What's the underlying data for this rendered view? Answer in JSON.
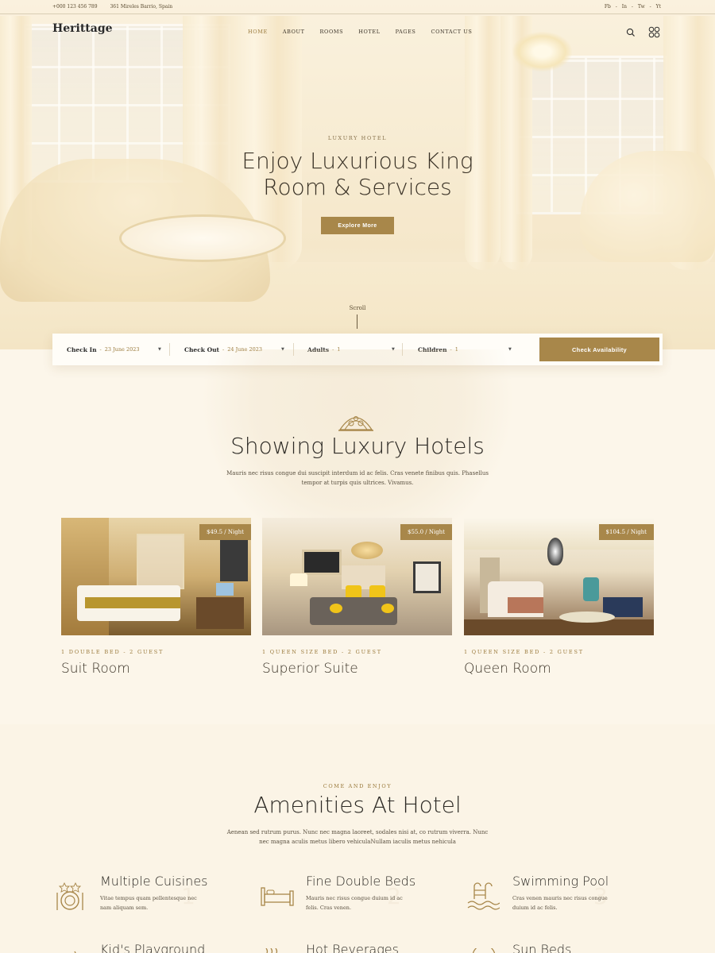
{
  "topbar": {
    "phone": "+000 123 456 789",
    "address": "361 Mireles Barrio, Spain",
    "social": [
      "Fb",
      "-",
      "In",
      "-",
      "Tw",
      "-",
      "Yt"
    ]
  },
  "brand": {
    "name": "Herittage",
    "tagline": ""
  },
  "nav": {
    "items": [
      "HOME",
      "ABOUT",
      "ROOMS",
      "HOTEL",
      "PAGES",
      "CONTACT US"
    ]
  },
  "hero": {
    "eyebrow": "LUXURY HOTEL",
    "title_line1": "Enjoy  Luxurious King",
    "title_line2": "Room & Services",
    "cta": "Explore More",
    "scroll": "Scroll"
  },
  "booking": {
    "checkin_label": "Check In",
    "checkin_value": "23 June 2023",
    "checkout_label": "Check Out",
    "checkout_value": "24 June 2023",
    "adults_label": "Adults",
    "adults_value": "1",
    "children_label": "Children",
    "children_value": "1",
    "button": "Check Availability"
  },
  "hotels": {
    "title": "Showing Luxury Hotels",
    "desc_line1": "Mauris nec risus congue dui suscipit interdum id ac felis. Cras venete finibus quis. Phasellus",
    "desc_line2": "tempor at turpis quis ultrices. Vivamus.",
    "rooms": [
      {
        "price": "$49.5 / Night",
        "meta": "1 DOUBLE BED - 2 GUEST",
        "name": "Suit Room"
      },
      {
        "price": "$55.0 / Night",
        "meta": "1 QUEEN SIZE BED - 2 GUEST",
        "name": "Superior Suite"
      },
      {
        "price": "$104.5 / Night",
        "meta": "1 QUEEN SIZE BED - 2 GUEST",
        "name": "Queen Room"
      }
    ]
  },
  "amenities": {
    "eyebrow": "COME AND ENJOY",
    "title": "Amenities At Hotel",
    "desc_line1": "Aenean sed rutrum purus. Nunc nec magna laoreet, sodales nisi at, co rutrum viverra. Nunc",
    "desc_line2": "nec magna aculis metus libero vehiculaNullam iaculis metus nehicula",
    "items": [
      {
        "title": "Multiple Cuisines",
        "desc": "Vitae tempus quam pellentesque nec nam aliquam sem.",
        "icon": "cuisine-icon"
      },
      {
        "title": "Fine Double Beds",
        "desc": "Mauris nec risus congue duium id ac felis. Cras venen.",
        "icon": "bed-icon"
      },
      {
        "title": "Swimming Pool",
        "desc": "Cras venen mauris nec risus congue duium id ac felis.",
        "icon": "pool-icon"
      },
      {
        "title": "Kid's Playground",
        "desc": "",
        "icon": "playground-icon"
      },
      {
        "title": "Hot Beverages",
        "desc": "",
        "icon": "beverage-icon"
      },
      {
        "title": "Sun Beds",
        "desc": "",
        "icon": "sunbed-icon"
      }
    ]
  },
  "colors": {
    "accent": "#a8874a",
    "background": "#fcf6ea",
    "text": "#2b2b2b"
  }
}
